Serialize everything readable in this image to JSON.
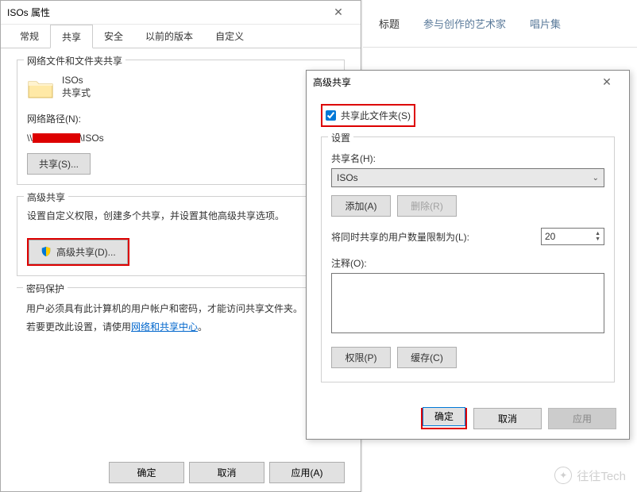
{
  "explorer": {
    "col_title": "标题",
    "col_artist": "参与创作的艺术家",
    "col_album": "唱片集"
  },
  "props": {
    "title": "ISOs 属性",
    "tabs": {
      "general": "常规",
      "sharing": "共享",
      "security": "安全",
      "prev": "以前的版本",
      "custom": "自定义"
    },
    "sec1": {
      "title": "网络文件和文件夹共享",
      "name": "ISOs",
      "status": "共享式",
      "pathlabel": "网络路径(N):",
      "path_prefix": "\\\\",
      "path_suffix": "\\ISOs",
      "share_btn": "共享(S)..."
    },
    "sec2": {
      "title": "高级共享",
      "desc": "设置自定义权限，创建多个共享，并设置其他高级共享选项。",
      "btn": "高级共享(D)..."
    },
    "sec3": {
      "title": "密码保护",
      "line1": "用户必须具有此计算机的用户帐户和密码，才能访问共享文件夹。",
      "line2_a": "若要更改此设置，请使用",
      "link": "网络和共享中心",
      "line2_b": "。"
    },
    "footer": {
      "ok": "确定",
      "cancel": "取消",
      "apply": "应用(A)"
    }
  },
  "adv": {
    "title": "高级共享",
    "checkbox": "共享此文件夹(S)",
    "settings_label": "设置",
    "shareName_label": "共享名(H):",
    "shareName": "ISOs",
    "add_btn": "添加(A)",
    "remove_btn": "删除(R)",
    "limit_label": "将同时共享的用户数量限制为(L):",
    "limit_value": "20",
    "comment_label": "注释(O):",
    "perm_btn": "权限(P)",
    "cache_btn": "缓存(C)",
    "ok": "确定",
    "cancel": "取消",
    "apply": "应用"
  },
  "watermark": "往往Tech"
}
